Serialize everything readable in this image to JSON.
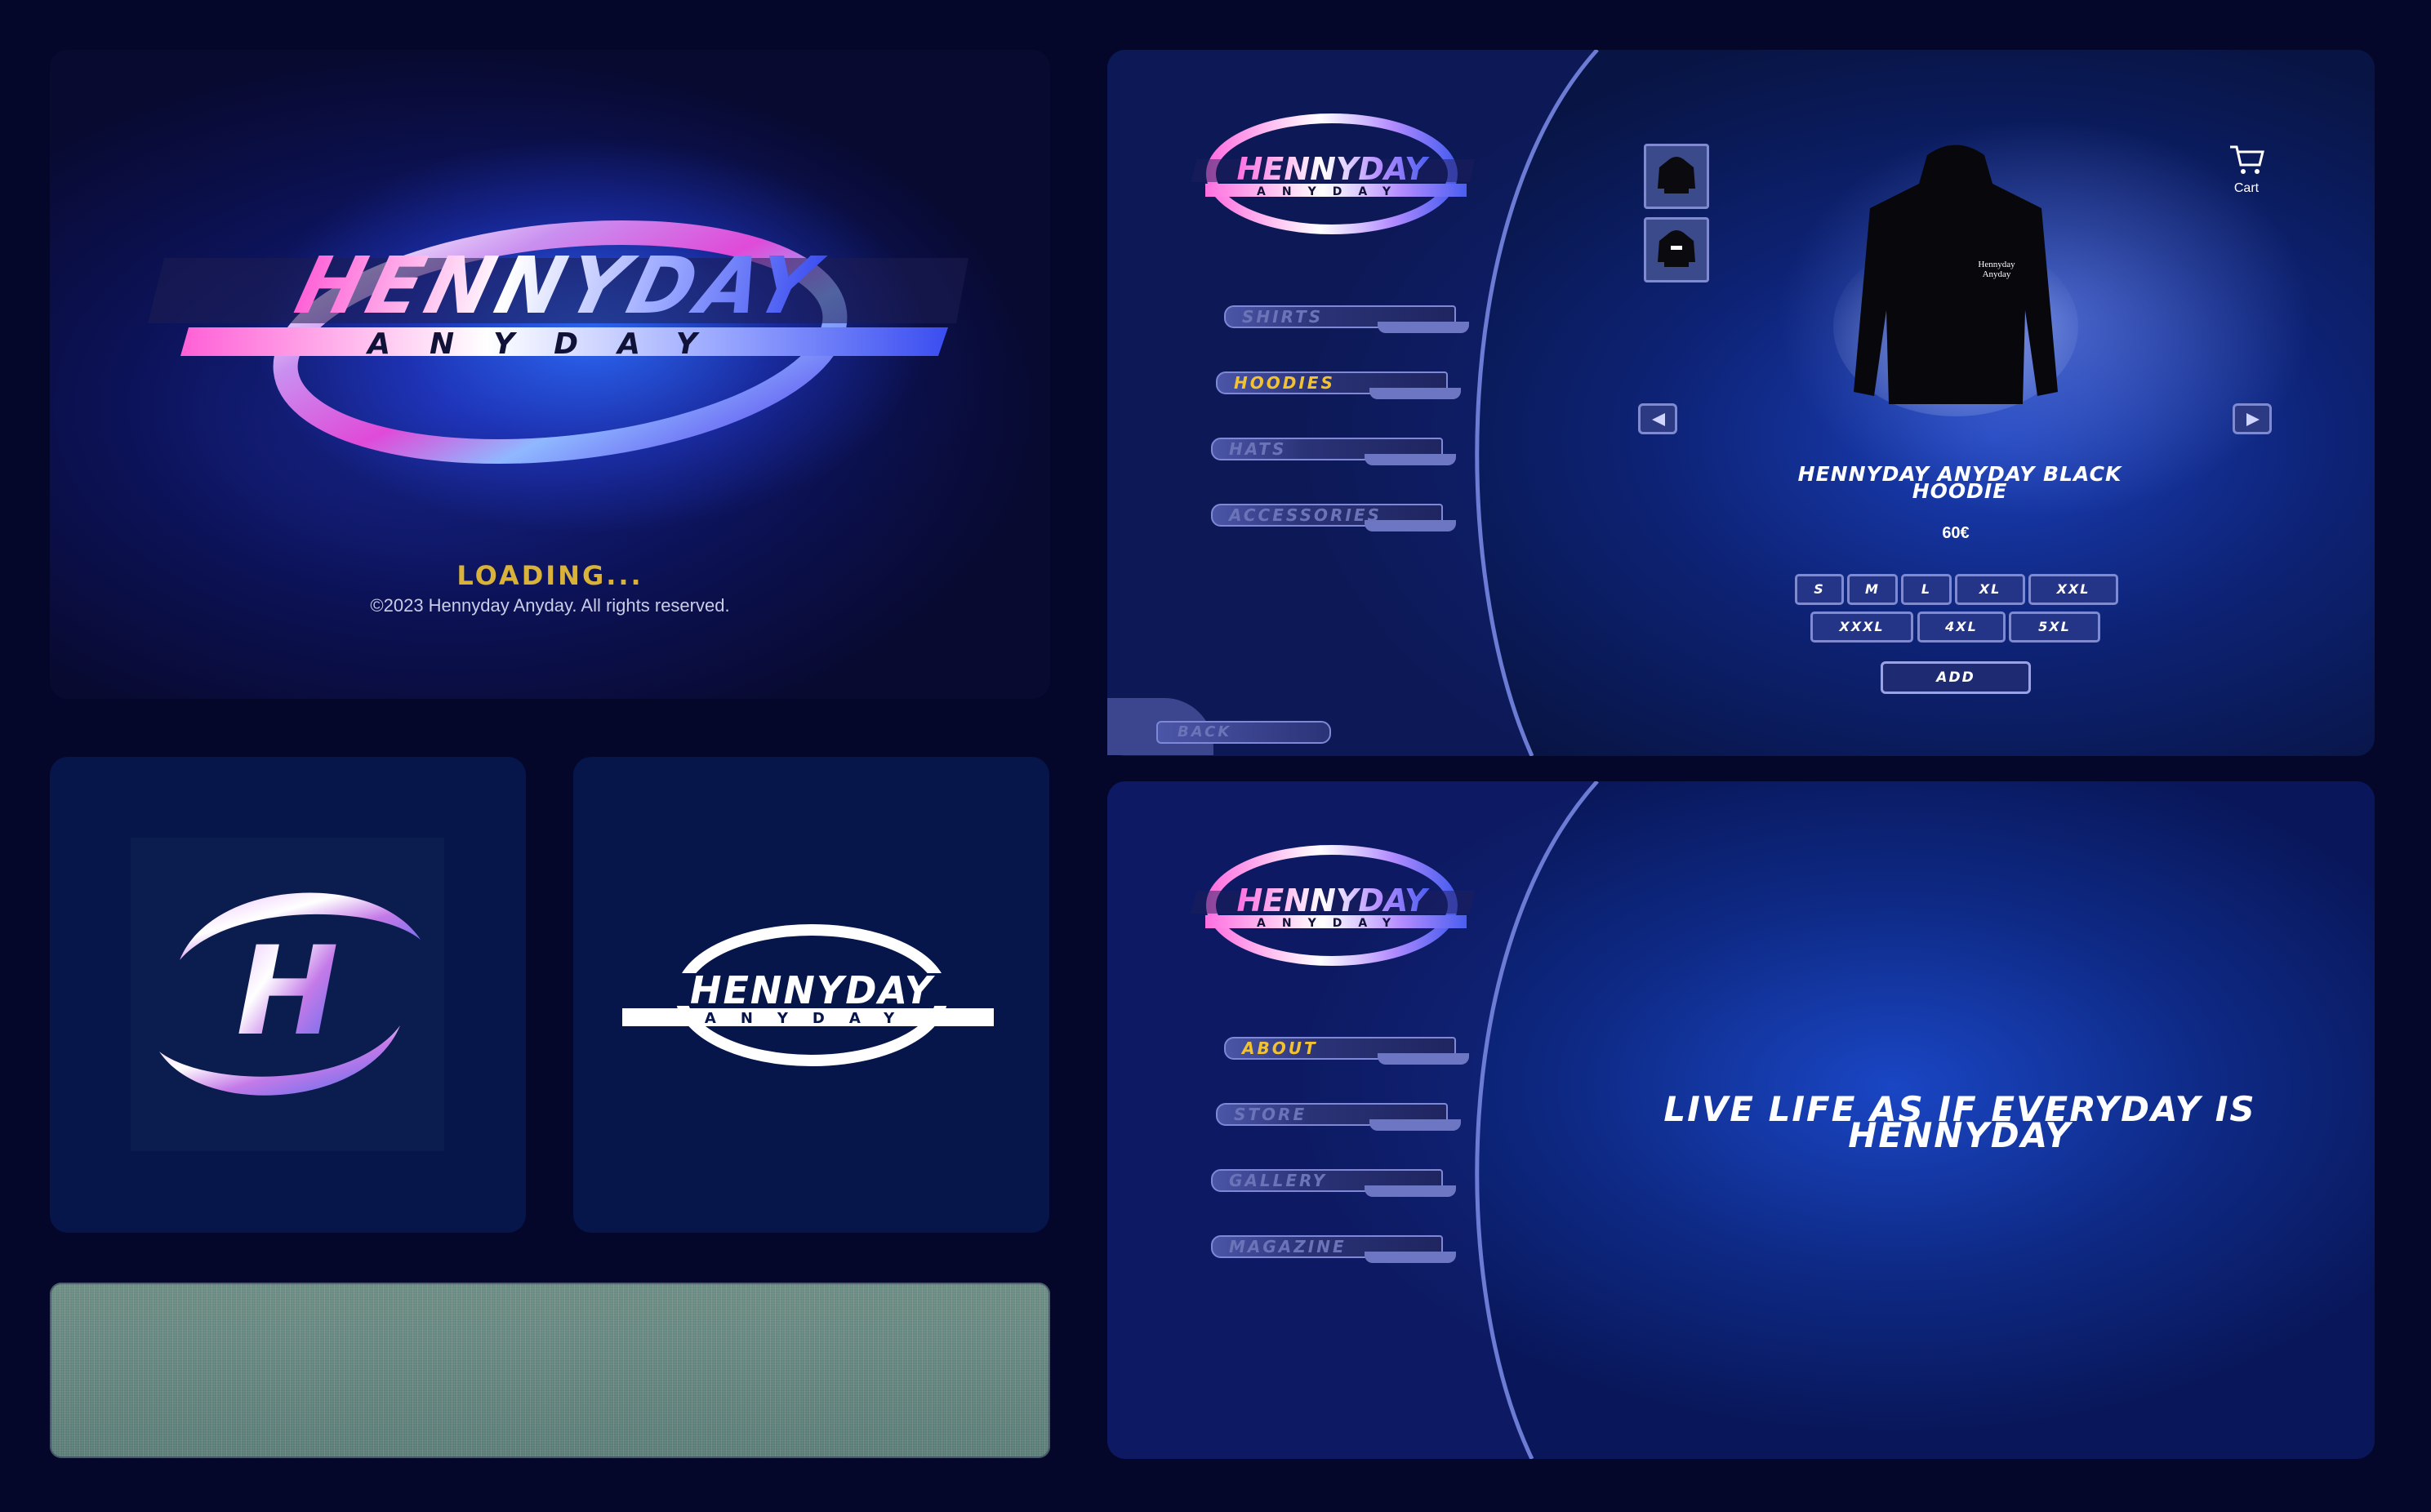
{
  "loading_screen": {
    "loading_text": "LOADING...",
    "copyright": "©2023 Hennyday Anyday. All rights reserved."
  },
  "brand": {
    "wordmark": "HENNYDAY",
    "sub": "ANYDAY",
    "monogram": "H"
  },
  "store": {
    "menu": [
      {
        "label": "SHIRTS",
        "active": false
      },
      {
        "label": "HOODIES",
        "active": true
      },
      {
        "label": "HATS",
        "active": false
      },
      {
        "label": "ACCESSORIES",
        "active": false
      }
    ],
    "cart_label": "Cart",
    "product": {
      "name": "HENNYDAY ANYDAY BLACK HOODIE",
      "price": "60€",
      "print_text_1": "Hennyday",
      "print_text_2": "Anyday"
    },
    "sizes_row1": [
      "S",
      "M",
      "L",
      "XL",
      "XXL"
    ],
    "sizes_row2": [
      "XXXL",
      "4XL",
      "5XL"
    ],
    "add_label": "ADD",
    "back_label": "BACK"
  },
  "about_page": {
    "menu": [
      {
        "label": "ABOUT",
        "active": true
      },
      {
        "label": "STORE",
        "active": false
      },
      {
        "label": "GALLERY",
        "active": false
      },
      {
        "label": "MAGAZINE",
        "active": false
      }
    ],
    "slogan": "LIVE LIFE AS IF EVERYDAY IS HENNYDAY"
  },
  "colors": {
    "page_bg": "#05072a",
    "accent_yellow": "#f2c230",
    "menu_text": "#6b74b8",
    "button_border": "#7f8ad0"
  }
}
